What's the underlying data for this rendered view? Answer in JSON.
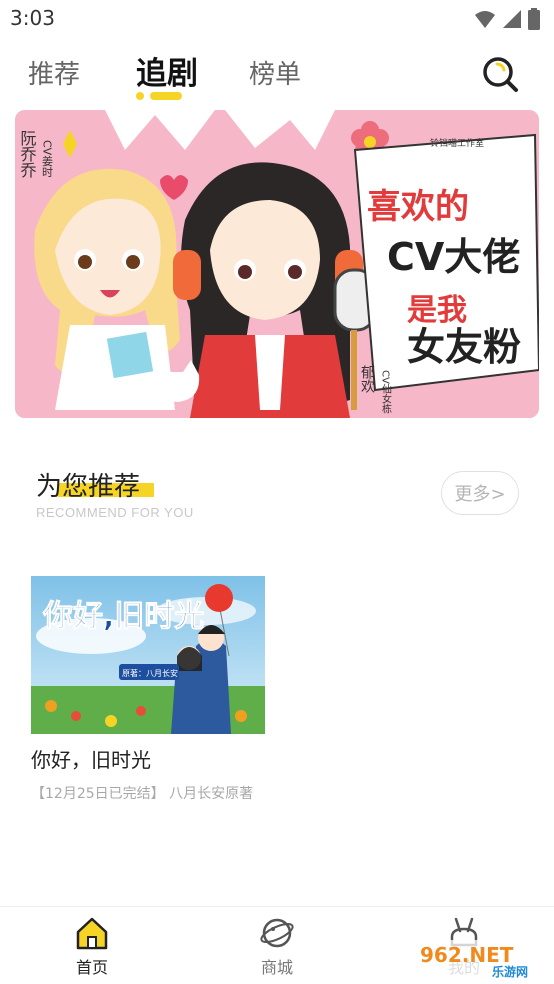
{
  "status_bar": {
    "time": "3:03"
  },
  "tabs": [
    {
      "label": "推荐"
    },
    {
      "label": "追剧"
    },
    {
      "label": "榜单"
    }
  ],
  "banner": {
    "studio_text": "铃铛喵工作室",
    "left_tag": "阮乔乔",
    "left_cv": "CV姜时",
    "right_cv": "CV仙女栋",
    "right_name": "郁欢",
    "headline_1": "喜欢的",
    "headline_2": "CV大佬",
    "headline_3": "是我",
    "headline_4": "女友粉"
  },
  "recommend": {
    "title": "为您推荐",
    "subtitle": "RECOMMEND FOR YOU",
    "more_label": "更多>"
  },
  "cards": [
    {
      "cover_title": "你好,旧时光",
      "cover_author": "原著：八月长安",
      "title": "你好，旧时光",
      "subtitle": "【12月25日已完结】 八月长安原著"
    }
  ],
  "bottom_nav": [
    {
      "label": "首页"
    },
    {
      "label": "商城"
    },
    {
      "label": "我的"
    }
  ],
  "watermark": {
    "text": "962.NET",
    "sub": "乐游网"
  },
  "colors": {
    "accent": "#f6d426",
    "banner_bg": "#f6b7c8"
  }
}
